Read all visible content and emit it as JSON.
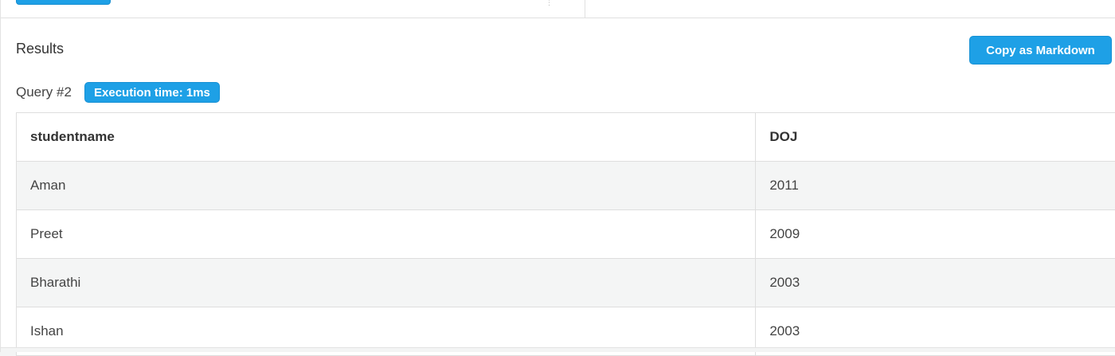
{
  "results": {
    "title": "Results",
    "copy_button_label": "Copy as Markdown"
  },
  "query": {
    "label": "Query #2",
    "execution_badge": "Execution time: 1ms"
  },
  "table": {
    "columns": [
      "studentname",
      "DOJ"
    ],
    "rows": [
      [
        "Aman",
        "2011"
      ],
      [
        "Preet",
        "2009"
      ],
      [
        "Bharathi",
        "2003"
      ],
      [
        "Ishan",
        "2003"
      ]
    ]
  },
  "colors": {
    "accent": "#1ea0e6",
    "row_stripe": "#f4f5f5",
    "border": "#dedede"
  }
}
